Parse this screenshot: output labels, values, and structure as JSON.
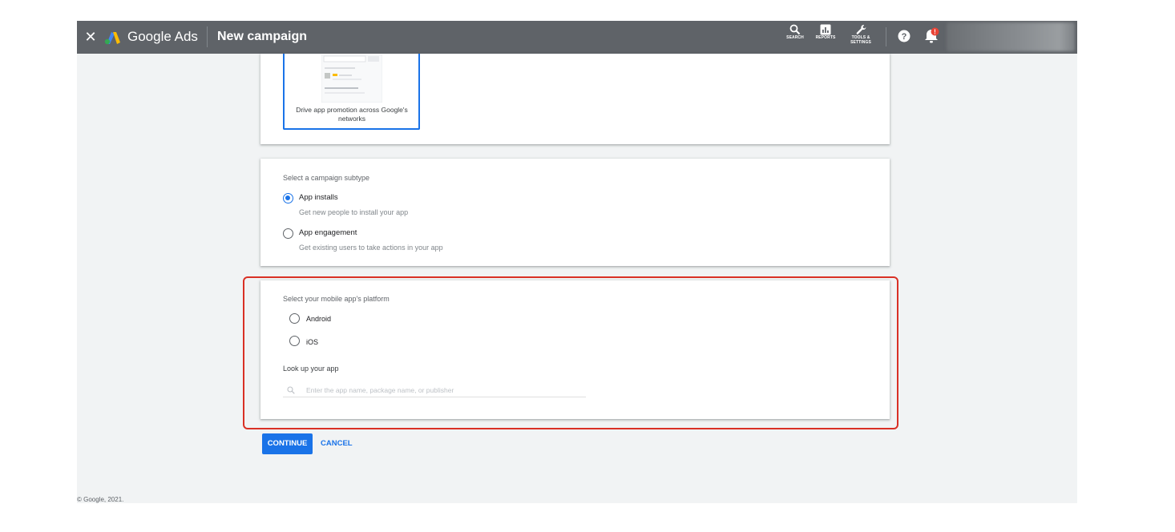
{
  "topbar": {
    "brand": "Google Ads",
    "title": "New campaign",
    "tools": [
      {
        "label": "SEARCH",
        "icon": "search-icon"
      },
      {
        "label": "REPORTS",
        "icon": "reports-icon"
      },
      {
        "label": "TOOLS &",
        "label2": "SETTINGS",
        "icon": "wrench-icon"
      }
    ],
    "notification_badge": "!"
  },
  "campaign_goal": {
    "caption": "Drive app promotion across Google's networks"
  },
  "subtype": {
    "label": "Select a campaign subtype",
    "options": [
      {
        "title": "App installs",
        "desc": "Get new people to install your app",
        "selected": true
      },
      {
        "title": "App engagement",
        "desc": "Get existing users to take actions in your app",
        "selected": false
      }
    ]
  },
  "platform": {
    "label": "Select your mobile app's platform",
    "options": [
      {
        "title": "Android",
        "selected": false
      },
      {
        "title": "iOS",
        "selected": false
      }
    ],
    "lookup_label": "Look up your app",
    "lookup_placeholder": "Enter the app name, package name, or publisher"
  },
  "actions": {
    "continue": "CONTINUE",
    "cancel": "CANCEL"
  },
  "footer": "© Google, 2021.",
  "colors": {
    "topbar": "#5f6368",
    "accent": "#1a73e8",
    "highlight": "#d93025",
    "badge": "#ea4335"
  }
}
